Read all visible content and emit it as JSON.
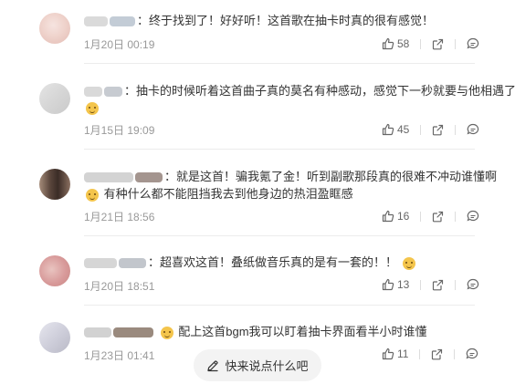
{
  "comments": [
    {
      "lines": [
        "：终于找到了！好好听！这首歌在抽卡时真的很有感觉！"
      ],
      "date": "1月20日 00:19",
      "likes": "58",
      "avatar_colors": [
        "#f0d6d2",
        "#e6c1bb"
      ],
      "name_blur_colors": [
        "#d8d8d8",
        "#b9c3cc"
      ]
    },
    {
      "lines": [
        "：抽卡的时候听着这首曲子真的莫名有种感动，感觉下一秒就要与他相遇了"
      ],
      "date": "1月15日 19:09",
      "likes": "45",
      "avatar_colors": [
        "#d9d9d9",
        "#cfcfcf"
      ],
      "name_blur_colors": [
        "#d6d6d6",
        "#c9ccd0"
      ]
    },
    {
      "lines": [
        "：就是这首！骗我氪了金！听到副歌那段真的很难不冲动谁懂啊",
        "有种什么都不能阻挡我去到他身边的热泪盈眶感"
      ],
      "date": "1月21日 18:56",
      "likes": "16",
      "avatar_colors": [
        "#6b5a50",
        "#c9b6a5"
      ],
      "name_blur_colors": [
        "#cfcfcf",
        "#9b8c86"
      ]
    },
    {
      "lines": [
        "：超喜欢这首！叠纸做音乐真的是有一套的！！"
      ],
      "date": "1月20日 18:51",
      "likes": "13",
      "avatar_colors": [
        "#d89a9a",
        "#e8c7bf"
      ],
      "name_blur_colors": [
        "#d5d5d5",
        "#c3c7cc"
      ]
    },
    {
      "lines": [
        "配上这首bgm我可以盯着抽卡界面看半小时谁懂"
      ],
      "date": "1月23日 01:41",
      "likes": "11",
      "avatar_colors": [
        "#d4d4e0",
        "#bdbdc9"
      ],
      "name_blur_colors": [
        "#d0d0d0",
        "#8f7f72"
      ]
    }
  ],
  "input": {
    "placeholder": "快来说点什么吧"
  },
  "icons": {
    "like": "thumbs-up-icon",
    "share": "share-icon",
    "reply": "reply-icon",
    "edit": "pencil-icon"
  }
}
